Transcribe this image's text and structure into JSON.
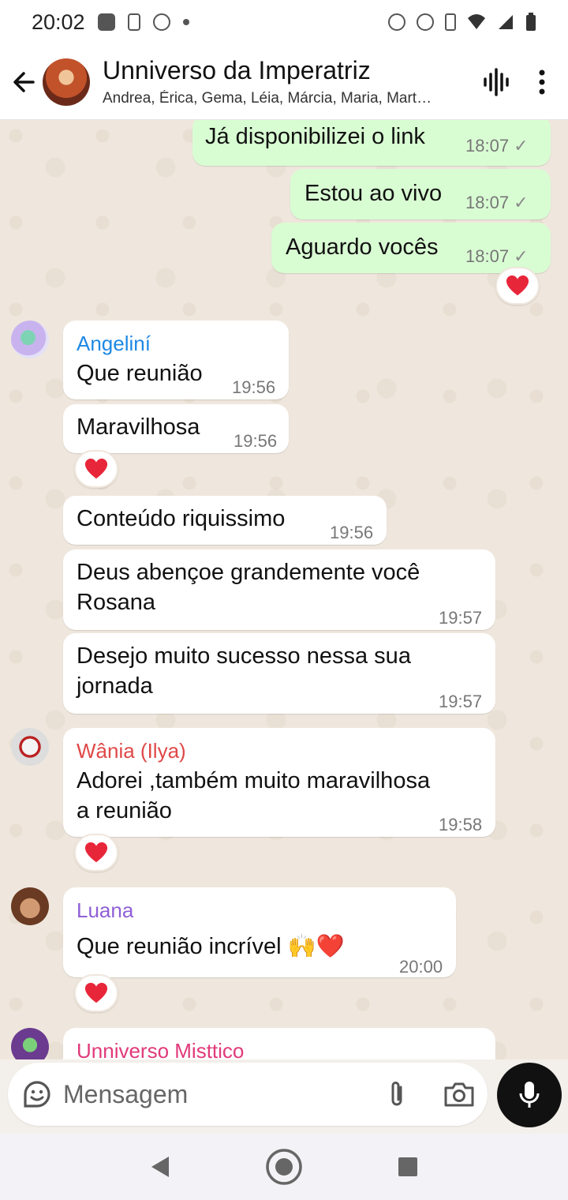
{
  "status_bar": {
    "time": "20:02"
  },
  "header": {
    "title": "Unniverso da Imperatriz",
    "subtitle": "Andrea, Érica, Gema, Léia, Márcia, Maria, Mart…"
  },
  "messages": [
    {
      "direction": "out",
      "text": "Já disponibilizei o link",
      "time": "18:07"
    },
    {
      "direction": "out",
      "text": "Estou ao vivo",
      "time": "18:07"
    },
    {
      "direction": "out",
      "text": "Aguardo vocês",
      "time": "18:07",
      "reaction": "heart"
    },
    {
      "direction": "in",
      "sender": "Angeliní",
      "text": "Que reunião",
      "time": "19:56"
    },
    {
      "direction": "in",
      "text": "Maravilhosa",
      "time": "19:56",
      "reaction": "heart"
    },
    {
      "direction": "in",
      "text": "Conteúdo riquissimo",
      "time": "19:56"
    },
    {
      "direction": "in",
      "text_line1": "Deus abençoe grandemente você",
      "text_line2": "Rosana",
      "time": "19:57"
    },
    {
      "direction": "in",
      "text_line1": "Desejo muito sucesso nessa sua",
      "text_line2": "jornada",
      "time": "19:57"
    },
    {
      "direction": "in",
      "sender": "Wânia (Ilya)",
      "text_line1": "Adorei ,também muito maravilhosa",
      "text_line2": "a reunião",
      "time": "19:58",
      "reaction": "heart"
    },
    {
      "direction": "in",
      "sender": "Luana",
      "text": "Que reunião incrível 🙌❤️",
      "time": "20:00",
      "reaction": "heart"
    },
    {
      "direction": "in",
      "sender": "Unniverso Misttico"
    }
  ],
  "composer": {
    "placeholder": "Mensagem"
  },
  "colors": {
    "outgoing_bubble": "#d9fdd3",
    "incoming_bubble": "#ffffff",
    "chat_bg": "#efe7dd",
    "sender_angelini": "#1e88e5",
    "sender_wania": "#e04848",
    "sender_luana": "#8f5fd6",
    "sender_misttico": "#e03a7a",
    "heart": "#e8263a"
  },
  "icons": [
    "back-arrow-icon",
    "audio-waveform-icon",
    "more-vert-icon",
    "sticker-icon",
    "attach-icon",
    "camera-icon",
    "mic-icon",
    "nav-back-icon",
    "nav-home-icon",
    "nav-recents-icon"
  ]
}
